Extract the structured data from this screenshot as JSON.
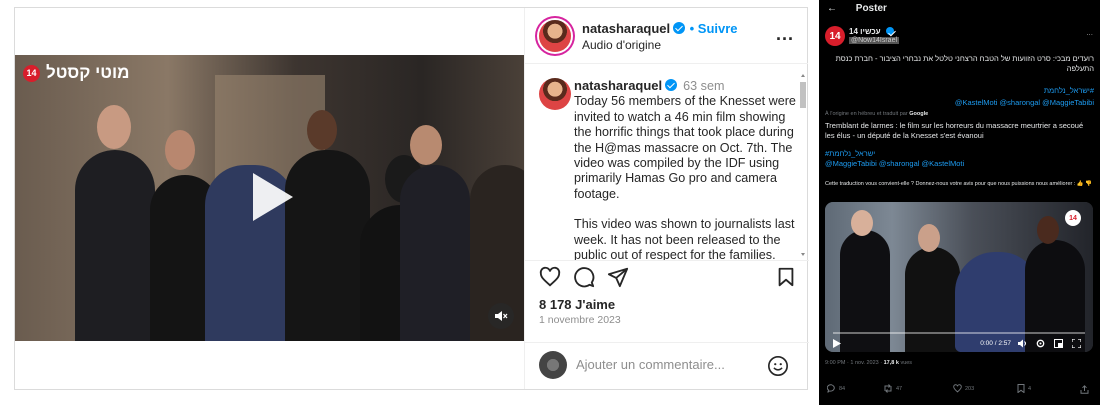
{
  "instagram": {
    "video": {
      "channel_text": "מוטי קסטל",
      "channel_badge": "14"
    },
    "header": {
      "username": "natasharaquel",
      "follow_label": "Suivre",
      "audio_label": "Audio d'origine",
      "more_label": "..."
    },
    "caption": {
      "username": "natasharaquel",
      "time": "63 sem",
      "paragraph1": "Today 56 members of the Knesset were invited to watch a 46 min film showing the horrific things that took place during the H@mas massacre on Oct. 7th. The video was compiled by the IDF using primarily Hamas Go pro and camera footage.",
      "paragraph2": "This video was shown to journalists last week. It has not been released to the public out of respect for the families."
    },
    "likes": "8 178 J'aime",
    "date": "1 novembre 2023",
    "comment_placeholder": "Ajouter un commentaire..."
  },
  "x": {
    "top_title": "Poster",
    "back_glyph": "←",
    "author_name": "14 עכשיו",
    "author_handle": "@Now14Israel",
    "more_label": "...",
    "hebrew_text": "רועדים מבכי: סרט הזוועות של הטבח הרצחני טלטל את נבחרי הציבור - חברת כנסת התעלפה",
    "hashtag1": "#ישראל_נלחמת",
    "mentions1": "@KastelMoti @sharongal @MaggieTabibi",
    "translated_prefix": "À l'origine en hébreu et traduit par",
    "translated_by": "Google",
    "french_text": "Tremblant de larmes : le film sur les horreurs du massacre meurtrier a secoué les élus - un député de la Knesset s'est évanoui",
    "hashtag2": "#ישראל_נלחמת",
    "mentions2": "@MaggieTabibi @sharongal @KastelMoti",
    "feedback": "Cette traduction vous convient-elle ? Donnez-nous votre avis pour que nous puissions nous améliorer :",
    "video_badge": "14",
    "timecode": "0:00 / 2:57",
    "meta_time": "9:00 PM · 1 nov. 2023 ·",
    "meta_views": "17,8 k",
    "meta_views_label": "vues",
    "stats": {
      "replies": "84",
      "reposts": "47",
      "likes": "203",
      "bookmarks": "4"
    }
  }
}
